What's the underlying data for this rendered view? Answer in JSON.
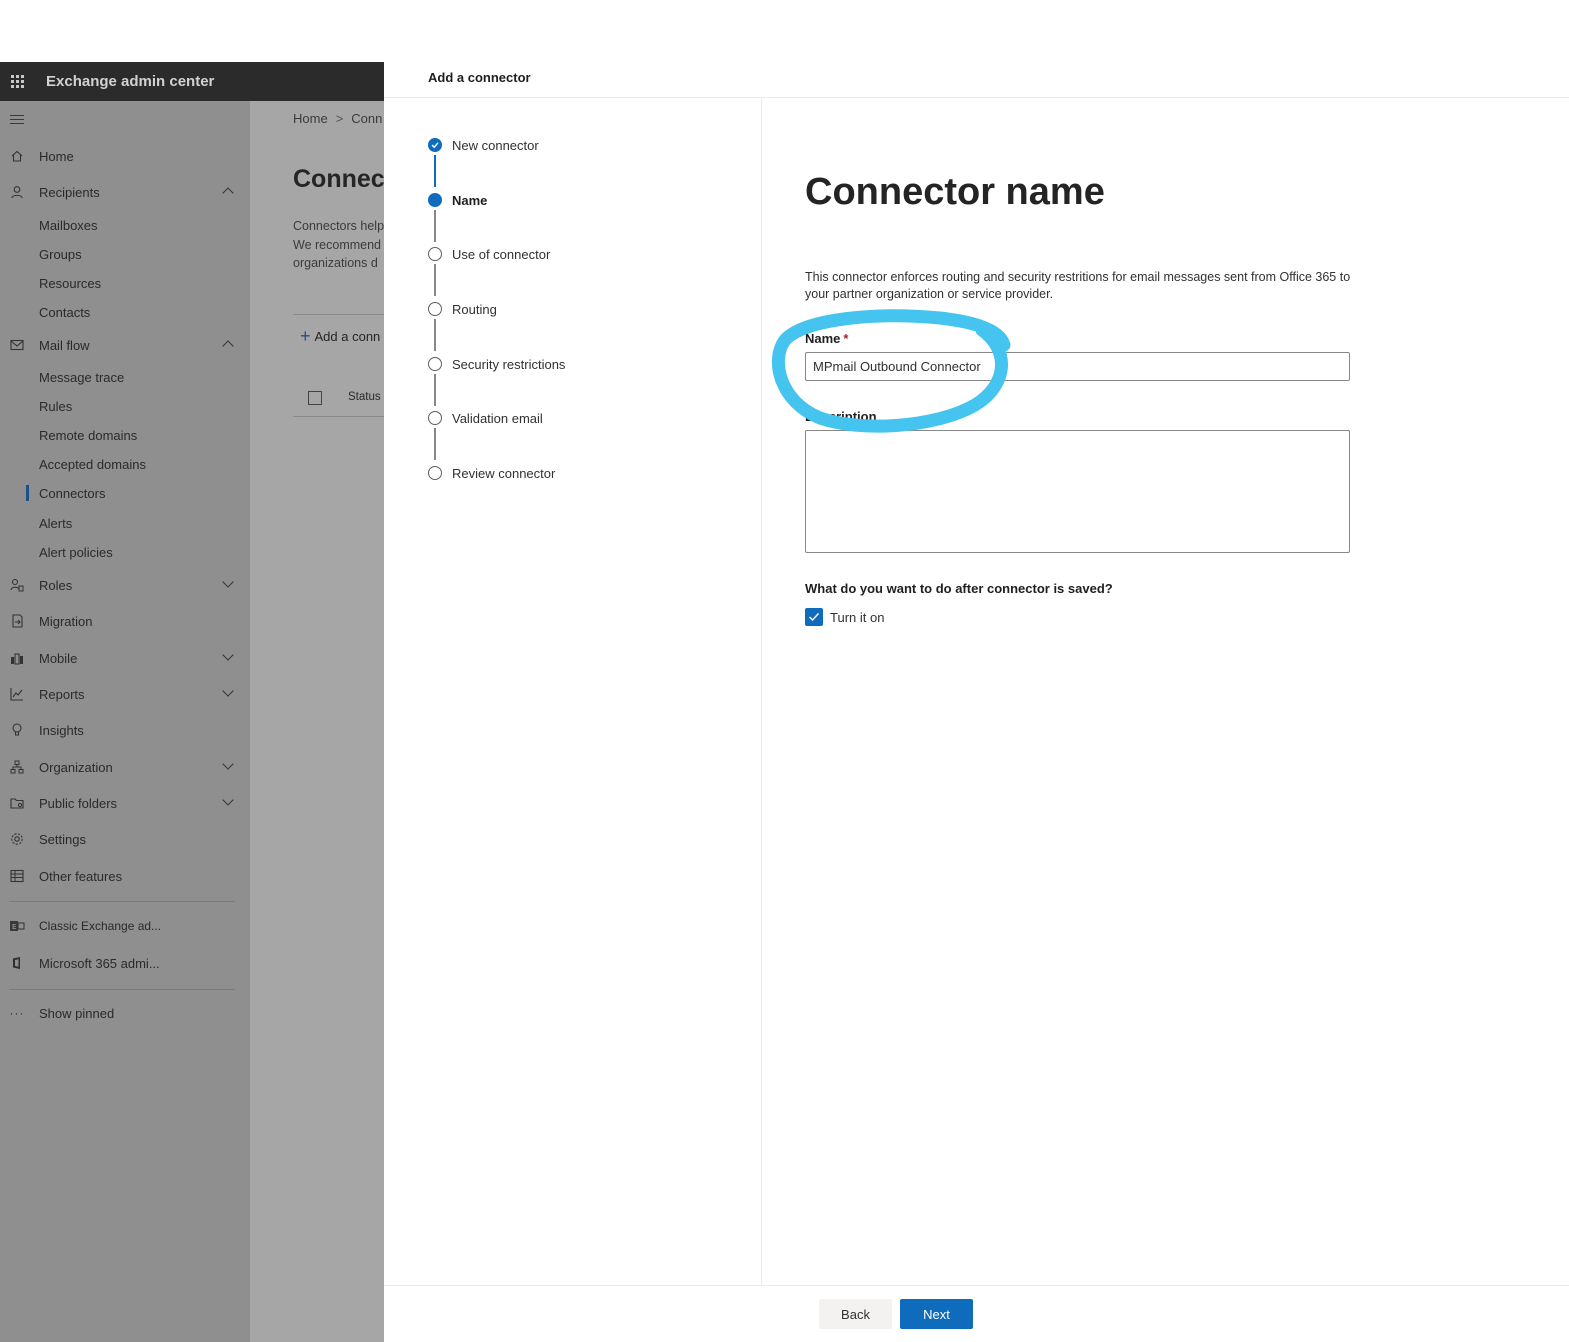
{
  "suite": {
    "title": "Exchange admin center"
  },
  "nav": {
    "items": [
      {
        "label": "Home"
      },
      {
        "label": "Recipients"
      },
      {
        "label": "Mail flow"
      },
      {
        "label": "Roles"
      },
      {
        "label": "Migration"
      },
      {
        "label": "Mobile"
      },
      {
        "label": "Reports"
      },
      {
        "label": "Insights"
      },
      {
        "label": "Organization"
      },
      {
        "label": "Public folders"
      },
      {
        "label": "Settings"
      },
      {
        "label": "Other features"
      },
      {
        "label": "Classic Exchange ad..."
      },
      {
        "label": "Microsoft 365 admi..."
      },
      {
        "label": "Show pinned"
      }
    ],
    "recipients_sub": [
      "Mailboxes",
      "Groups",
      "Resources",
      "Contacts"
    ],
    "mailflow_sub": [
      "Message trace",
      "Rules",
      "Remote domains",
      "Accepted domains",
      "Connectors",
      "Alerts",
      "Alert policies"
    ]
  },
  "background_page": {
    "breadcrumb_home": "Home",
    "breadcrumb_current": "Conn",
    "title": "Connect",
    "desc_lines": [
      "Connectors help",
      "We recommend",
      "organizations d"
    ],
    "add_label": "Add a conn",
    "status_col": "Status"
  },
  "panel": {
    "title": "Add a connector",
    "steps": [
      "New connector",
      "Name",
      "Use of connector",
      "Routing",
      "Security restrictions",
      "Validation email",
      "Review connector"
    ],
    "heading": "Connector name",
    "intro": "This connector enforces routing and security restritions for email messages sent from Office 365 to your partner organization or service provider.",
    "name_label": "Name",
    "required_mark": "*",
    "name_value": "MPmail Outbound Connector",
    "description_label": "Description",
    "description_value": "",
    "question": "What do you want to do after connector is saved?",
    "turn_on_label": "Turn it on",
    "turn_on_checked": true,
    "back_label": "Back",
    "next_label": "Next"
  },
  "colors": {
    "accent": "#0f6cbd",
    "annotation": "#44c4ee"
  }
}
